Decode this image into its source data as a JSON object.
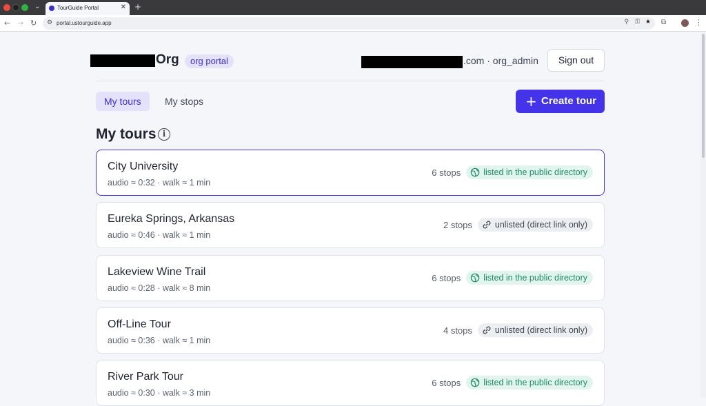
{
  "browser": {
    "tab_title": "TourGuide Portal",
    "tab_close": "✕",
    "new_tab": "+",
    "url": "portal.ustourguide.app",
    "back": "←",
    "forward": "→",
    "reload": "↻",
    "menu": "⋮"
  },
  "header": {
    "org_suffix": "Org",
    "org_badge": "org portal",
    "user_suffix": ".com · org_admin",
    "signout_label": "Sign out"
  },
  "nav": {
    "tabs": [
      {
        "label": "My tours",
        "active": true
      },
      {
        "label": "My stops",
        "active": false
      }
    ],
    "create_label": "Create tour"
  },
  "section": {
    "title": "My tours",
    "info_glyph": "i"
  },
  "tours": [
    {
      "title": "City University",
      "meta": "audio ≈ 0:32 · walk ≈ 1 min",
      "stops": "6 stops",
      "visibility": "listed in the public directory",
      "listed": true,
      "active": true
    },
    {
      "title": "Eureka Springs, Arkansas",
      "meta": "audio ≈ 0:46 · walk ≈ 1 min",
      "stops": "2 stops",
      "visibility": "unlisted (direct link only)",
      "listed": false,
      "active": false
    },
    {
      "title": "Lakeview Wine Trail",
      "meta": "audio ≈ 0:28 · walk ≈ 8 min",
      "stops": "6 stops",
      "visibility": "listed in the public directory",
      "listed": true,
      "active": false
    },
    {
      "title": "Off-Line Tour",
      "meta": "audio ≈ 0:36 · walk ≈ 1 min",
      "stops": "4 stops",
      "visibility": "unlisted (direct link only)",
      "listed": false,
      "active": false
    },
    {
      "title": "River Park Tour",
      "meta": "audio ≈ 0:30 · walk ≈ 3 min",
      "stops": "6 stops",
      "visibility": "listed in the public directory",
      "listed": true,
      "active": false
    }
  ],
  "colors": {
    "accent": "#4433e8",
    "listed_badge_bg": "#e2f4ee",
    "listed_badge_text": "#1f8a6a",
    "unlisted_badge_bg": "#eceef1"
  },
  "icons": {
    "listed": "globe-icon",
    "unlisted": "link-icon"
  }
}
